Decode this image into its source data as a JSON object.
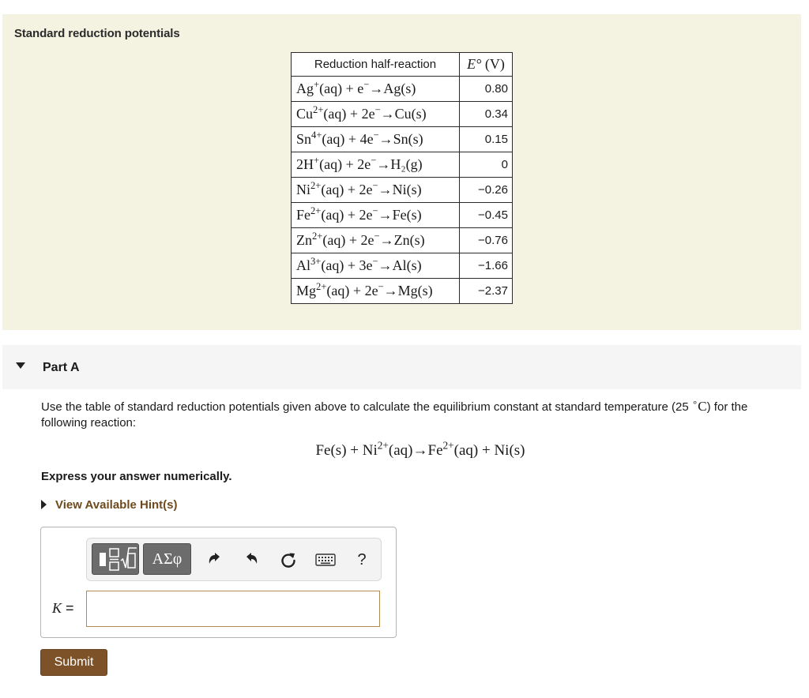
{
  "intro": {
    "title": "Standard reduction potentials",
    "table": {
      "col_reaction": "Reduction half-reaction",
      "col_potential_symbol": "E°",
      "col_potential_unit": "(V)",
      "rows": [
        {
          "reactant": "Ag",
          "charge": "+",
          "electrons": "e",
          "product": "Ag(s)",
          "value": "0.80"
        },
        {
          "reactant": "Cu",
          "charge": "2+",
          "electrons": "2e",
          "product": "Cu(s)",
          "value": "0.34"
        },
        {
          "reactant": "Sn",
          "charge": "4+",
          "electrons": "4e",
          "product": "Sn(s)",
          "value": "0.15"
        },
        {
          "reactant": "2H",
          "charge": "+",
          "electrons": "2e",
          "product": "H₂(g)",
          "value": "0"
        },
        {
          "reactant": "Ni",
          "charge": "2+",
          "electrons": "2e",
          "product": "Ni(s)",
          "value": "−0.26"
        },
        {
          "reactant": "Fe",
          "charge": "2+",
          "electrons": "2e",
          "product": "Fe(s)",
          "value": "−0.45"
        },
        {
          "reactant": "Zn",
          "charge": "2+",
          "electrons": "2e",
          "product": "Zn(s)",
          "value": "−0.76"
        },
        {
          "reactant": "Al",
          "charge": "3+",
          "electrons": "3e",
          "product": "Al(s)",
          "value": "−1.66"
        },
        {
          "reactant": "Mg",
          "charge": "2+",
          "electrons": "2e",
          "product": "Mg(s)",
          "value": "−2.37"
        }
      ]
    }
  },
  "part": {
    "title": "Part A",
    "question_main": "Use the table of standard reduction potentials given above to calculate the equilibrium constant at standard temperature (25",
    "question_unit": "C",
    "question_tail": ") for the following reaction:",
    "equation": {
      "lhs1": "Fe(s) + Ni",
      "lhs1_charge": "2+",
      "lhs2": "(aq)",
      "arrow": "→",
      "rhs1": "Fe",
      "rhs1_charge": "2+",
      "rhs2": "(aq) + Ni(s)"
    },
    "instruction": "Express your answer numerically.",
    "hints_label": "View Available Hint(s)"
  },
  "answer": {
    "greek_label": "ΑΣφ",
    "help_label": "?",
    "k_symbol": "K",
    "equals": "=",
    "input_value": ""
  },
  "submit_label": "Submit",
  "colors": {
    "intro_bg": "#f4f2e1",
    "accent_brown": "#7d5228",
    "hint_text": "#6e4a1d",
    "toolbar_button": "#6c6c6c"
  },
  "icons": [
    "templates-icon",
    "undo-icon",
    "redo-icon",
    "reset-icon",
    "keyboard-icon",
    "help-icon"
  ]
}
